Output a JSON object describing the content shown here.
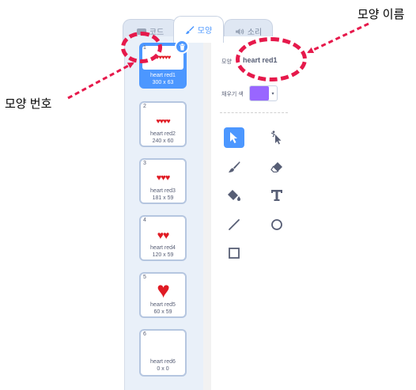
{
  "tabs": [
    {
      "label": "코드",
      "icon": "code-icon",
      "active": false
    },
    {
      "label": "모양",
      "icon": "paintbrush-icon",
      "active": true
    },
    {
      "label": "소리",
      "icon": "speaker-icon",
      "active": false
    }
  ],
  "costumes": [
    {
      "number": "1",
      "name": "heart red1",
      "size": "300 x 63",
      "hearts": "♥♥♥♥♥",
      "selected": true
    },
    {
      "number": "2",
      "name": "heart red2",
      "size": "240 x 60",
      "hearts": "♥♥♥♥",
      "selected": false
    },
    {
      "number": "3",
      "name": "heart red3",
      "size": "181 x 59",
      "hearts": "♥♥♥",
      "selected": false
    },
    {
      "number": "4",
      "name": "heart red4",
      "size": "120 x 59",
      "hearts": "♥♥",
      "selected": false
    },
    {
      "number": "5",
      "name": "heart red5",
      "size": "60 x 59",
      "hearts": "♥",
      "selected": false
    },
    {
      "number": "6",
      "name": "heart red6",
      "size": "0 x 0",
      "hearts": "",
      "selected": false
    }
  ],
  "editor": {
    "costume_label": "모양",
    "costume_name": "heart red1",
    "fill_label": "채우기 색",
    "fill_color": "#9966ff",
    "tools": [
      "select-icon",
      "reshape-icon",
      "brush-icon",
      "eraser-icon",
      "fill-icon",
      "text-icon",
      "line-icon",
      "circle-icon",
      "rectangle-icon"
    ]
  },
  "annotations": {
    "costume_name": "모양 이름",
    "costume_number": "모양 번호",
    "color": "#e6194b"
  }
}
